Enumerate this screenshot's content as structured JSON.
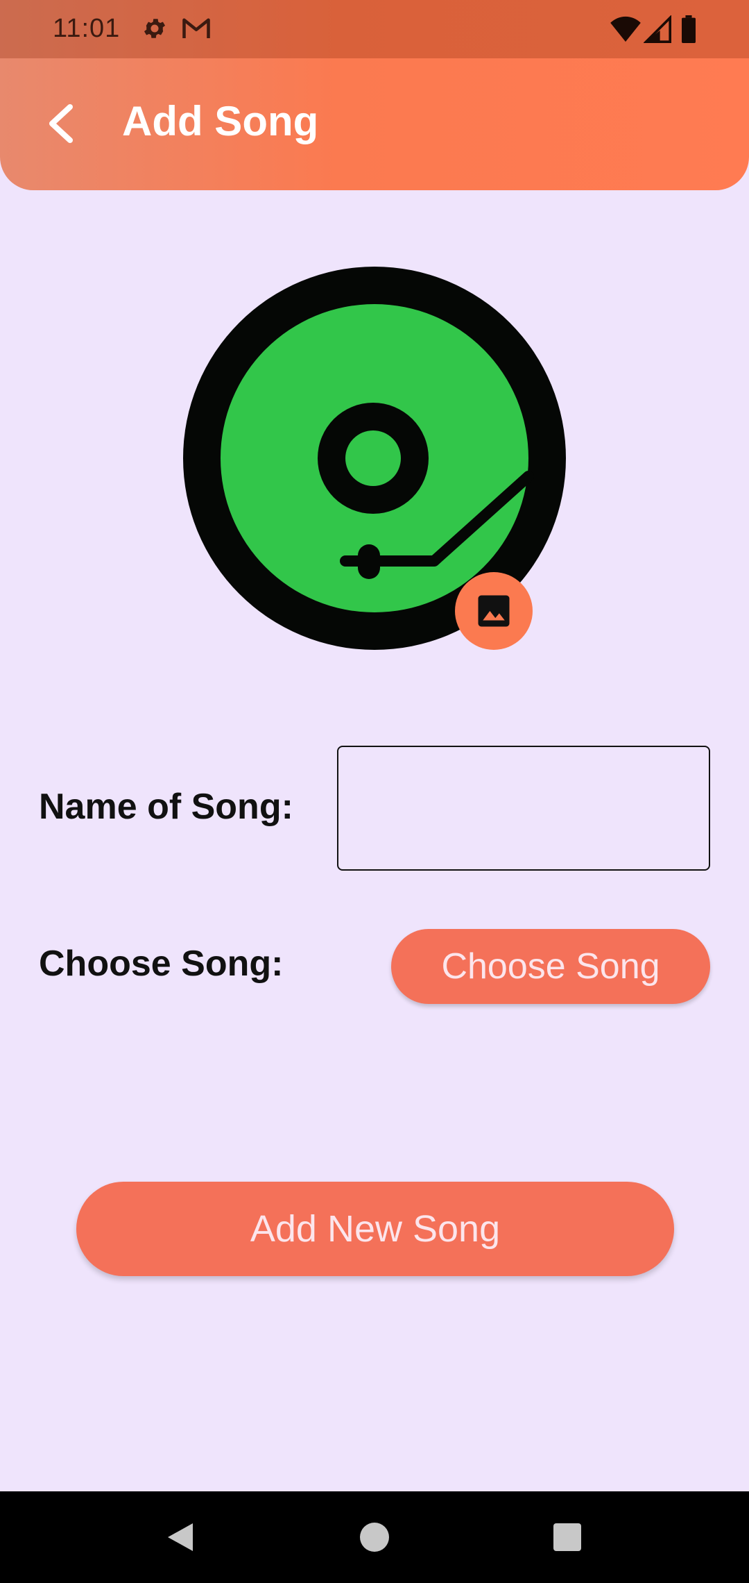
{
  "status_bar": {
    "time": "11:01",
    "icons": [
      "gear-icon",
      "gmail-icon",
      "wifi-icon",
      "signal-icon",
      "battery-icon"
    ]
  },
  "app_bar": {
    "title": "Add Song",
    "back_icon": "chevron-left-icon"
  },
  "album": {
    "art_icon": "turntable-record-icon",
    "picker_icon": "image-icon"
  },
  "form": {
    "name_label": "Name of Song:",
    "name_value": "",
    "choose_label": "Choose Song:",
    "choose_button_label": "Choose Song",
    "submit_label": "Add New Song"
  },
  "nav_bar": {
    "icons": [
      "nav-back-icon",
      "nav-home-icon",
      "nav-recents-icon"
    ]
  },
  "colors": {
    "background": "#EFE4FC",
    "appbar_gradient_start": "#E8896D",
    "appbar_gradient_end": "#FF7B52",
    "button": "#F47159",
    "button_text": "#FCE5EC",
    "record_green": "#32C64A",
    "record_black": "#050705"
  }
}
